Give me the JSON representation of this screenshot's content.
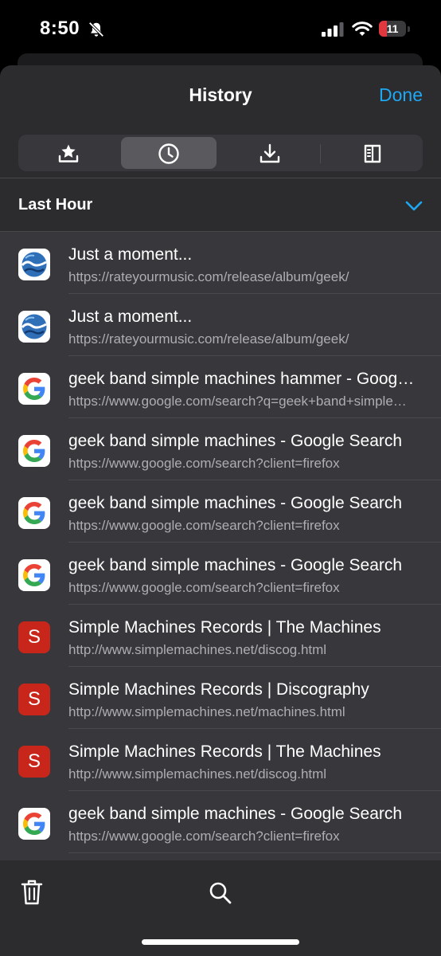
{
  "status_bar": {
    "time": "8:50",
    "battery_level": "11",
    "battery_fraction": 0.11,
    "icons": [
      "bell-slash-icon",
      "cellular-signal-icon",
      "wifi-icon",
      "battery-icon"
    ]
  },
  "header": {
    "title": "History",
    "done_label": "Done"
  },
  "tabs": [
    {
      "icon": "bookmark-star-icon",
      "selected": false
    },
    {
      "icon": "clock-icon",
      "selected": true
    },
    {
      "icon": "download-icon",
      "selected": false
    },
    {
      "icon": "reading-list-icon",
      "selected": false
    }
  ],
  "section": {
    "title": "Last Hour",
    "expanded": true
  },
  "history": [
    {
      "favicon": "rym",
      "title": "Just a moment...",
      "url": "https://rateyourmusic.com/release/album/geek/"
    },
    {
      "favicon": "rym",
      "title": "Just a moment...",
      "url": "https://rateyourmusic.com/release/album/geek/"
    },
    {
      "favicon": "google",
      "title": "geek band simple machines hammer - Google Search",
      "url": "https://www.google.com/search?q=geek+band+simple+machines+hammer"
    },
    {
      "favicon": "google",
      "title": "geek band simple machines - Google Search",
      "url": "https://www.google.com/search?client=firefox"
    },
    {
      "favicon": "google",
      "title": "geek band simple machines - Google Search",
      "url": "https://www.google.com/search?client=firefox"
    },
    {
      "favicon": "google",
      "title": "geek band simple machines - Google Search",
      "url": "https://www.google.com/search?client=firefox"
    },
    {
      "favicon": "s",
      "favicon_letter": "S",
      "title": "Simple Machines Records | The Machines",
      "url": "http://www.simplemachines.net/discog.html"
    },
    {
      "favicon": "s",
      "favicon_letter": "S",
      "title": "Simple Machines Records | Discography",
      "url": "http://www.simplemachines.net/machines.html"
    },
    {
      "favicon": "s",
      "favicon_letter": "S",
      "title": "Simple Machines Records | The Machines",
      "url": "http://www.simplemachines.net/discog.html"
    },
    {
      "favicon": "google",
      "title": "geek band simple machines - Google Search",
      "url": "https://www.google.com/search?client=firefox"
    }
  ],
  "toolbar": {
    "icons": [
      "trash-icon",
      "search-icon"
    ]
  },
  "colors": {
    "accent": "#1ea7f2",
    "battery_low": "#e0383e",
    "sheet_bg": "#2c2c2e",
    "list_bg": "#38383c",
    "favicon_s": "#c8261b"
  }
}
